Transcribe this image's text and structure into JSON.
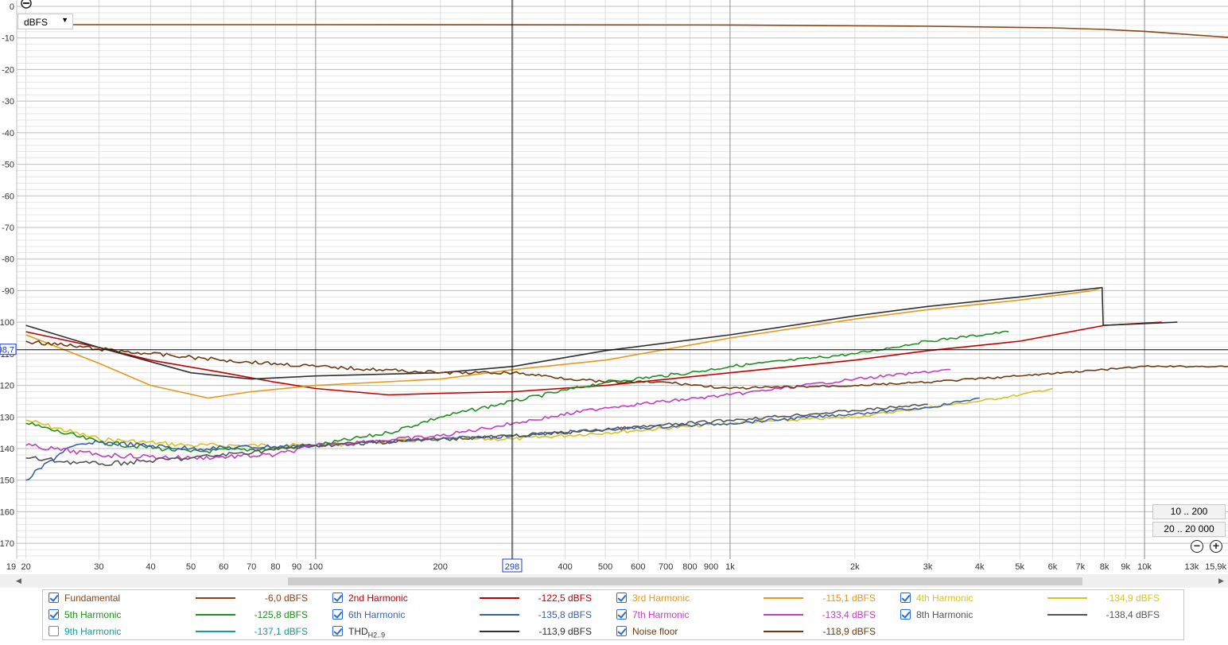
{
  "toolbar": {
    "unit_dropdown": "dBFS",
    "range_button_1": "10 .. 200",
    "range_button_2": "20 .. 20 000"
  },
  "cursor": {
    "x_label": "298",
    "y_label": "98,7"
  },
  "icons": [
    "zoom-out-icon",
    "zoom-in-icon",
    "chevron-down-icon",
    "arrow-left-icon",
    "arrow-right-icon",
    "checkbox-icon"
  ],
  "legend": [
    {
      "name": "Fundamental",
      "value": "-6,0 dBFS",
      "checked": true,
      "color": "#8b4513"
    },
    {
      "name": "2nd Harmonic",
      "value": "-122,5 dBFS",
      "checked": true,
      "color": "#c00000"
    },
    {
      "name": "3rd Harmonic",
      "value": "-115,1 dBFS",
      "checked": true,
      "color": "#e39a1a"
    },
    {
      "name": "4th Harmonic",
      "value": "-134,9 dBFS",
      "checked": true,
      "color": "#d9c41a"
    },
    {
      "name": "5th Harmonic",
      "value": "-125,8 dBFS",
      "checked": true,
      "color": "#1f8f1f"
    },
    {
      "name": "6th Harmonic",
      "value": "-135,8 dBFS",
      "checked": true,
      "color": "#3c60a8"
    },
    {
      "name": "7th Harmonic",
      "value": "-133,4 dBFS",
      "checked": true,
      "color": "#c040c0"
    },
    {
      "name": "8th Harmonic",
      "value": "-138,4 dBFS",
      "checked": true,
      "color": "#555555"
    },
    {
      "name": "9th Harmonic",
      "value": "-137,1 dBFS",
      "checked": false,
      "color": "#1a9a9a"
    },
    {
      "name": "THD",
      "name_sub": "H2..9",
      "value": "-113,9 dBFS",
      "checked": true,
      "color": "#303030"
    },
    {
      "name": "Noise floor",
      "value": "-118,9 dBFS",
      "checked": true,
      "color": "#6b3a10"
    }
  ],
  "chart_data": {
    "type": "line",
    "x_scale": "log",
    "x_unit": "Hz",
    "xlim": [
      19,
      15900
    ],
    "ylim": [
      0,
      -175
    ],
    "grid": true,
    "y_ticks": [
      0,
      -10,
      -20,
      -30,
      -40,
      -50,
      -60,
      -70,
      -80,
      -90,
      -100,
      -110,
      -120,
      -130,
      -140,
      -150,
      -160,
      -170
    ],
    "y_tick_labels": [
      "0",
      "-10",
      "-20",
      "-30",
      "-40",
      "-50",
      "-60",
      "-70",
      "-80",
      "-90",
      "100",
      "110",
      "120",
      "130",
      "140",
      "150",
      "160",
      "170"
    ],
    "x_ticks": [
      19,
      20,
      30,
      40,
      50,
      60,
      70,
      80,
      90,
      100,
      200,
      400,
      500,
      600,
      700,
      800,
      900,
      1000,
      2000,
      3000,
      4000,
      5000,
      6000,
      7000,
      8000,
      9000,
      10000,
      13000,
      15900
    ],
    "x_tick_labels": [
      "19",
      "20",
      "30",
      "40",
      "50",
      "60",
      "70",
      "80",
      "90",
      "100",
      "200",
      "400",
      "500",
      "600",
      "700",
      "800",
      "900",
      "1k",
      "2k",
      "3k",
      "4k",
      "5k",
      "6k",
      "7k",
      "8k",
      "9k",
      "10k",
      "13k",
      "15,9k"
    ],
    "cursor": {
      "x": 298,
      "y": -108.7
    },
    "series": [
      {
        "name": "Fundamental",
        "color": "#8b4513",
        "x": [
          20,
          100,
          1000,
          3000,
          6000,
          8000,
          10000,
          13000,
          15900
        ],
        "y": [
          -5.8,
          -5.8,
          -5.9,
          -6.3,
          -6.8,
          -7.3,
          -7.9,
          -9.0,
          -9.8
        ]
      },
      {
        "name": "2nd Harmonic",
        "color": "#c00000",
        "x": [
          20,
          30,
          40,
          60,
          80,
          100,
          150,
          200,
          300,
          500,
          1000,
          2000,
          3000,
          5000,
          8000,
          11000
        ],
        "y": [
          -103,
          -108,
          -112,
          -116,
          -119,
          -121,
          -123,
          -122.5,
          -122,
          -120,
          -116,
          -112,
          -109,
          -106,
          -101,
          -100
        ]
      },
      {
        "name": "3rd Harmonic",
        "color": "#e39a1a",
        "x": [
          20,
          30,
          40,
          55,
          70,
          100,
          200,
          300,
          500,
          1000,
          2000,
          3000,
          5000,
          7500,
          7900
        ],
        "y": [
          -104,
          -113,
          -120,
          -124,
          -122,
          -120,
          -118,
          -115,
          -112,
          -105,
          -99,
          -96,
          -93,
          -90,
          -89
        ]
      },
      {
        "name": "4th Harmonic",
        "color": "#d9c41a",
        "x": [
          20,
          30,
          50,
          100,
          200,
          300,
          500,
          800,
          1000,
          2000,
          3000,
          4000,
          5000,
          6000
        ],
        "y": [
          -131,
          -137,
          -139,
          -139,
          -137,
          -137,
          -135,
          -133,
          -132,
          -130,
          -127,
          -125,
          -123,
          -121
        ]
      },
      {
        "name": "5th Harmonic",
        "color": "#1f8f1f",
        "x": [
          20,
          30,
          50,
          80,
          100,
          150,
          200,
          300,
          500,
          800,
          1000,
          2000,
          3000,
          4700
        ],
        "y": [
          -132,
          -138,
          -141,
          -140,
          -139,
          -135,
          -130,
          -125,
          -119,
          -116,
          -114,
          -110,
          -106,
          -103
        ]
      },
      {
        "name": "6th Harmonic",
        "color": "#3c60a8",
        "x": [
          20,
          25,
          30,
          50,
          100,
          200,
          300,
          500,
          1000,
          2000,
          3000,
          4000
        ],
        "y": [
          -150,
          -140,
          -138,
          -140,
          -139,
          -137,
          -136,
          -134,
          -132,
          -129,
          -127,
          -124
        ]
      },
      {
        "name": "7th Harmonic",
        "color": "#c040c0",
        "x": [
          20,
          30,
          50,
          80,
          100,
          200,
          300,
          500,
          1000,
          2000,
          3400
        ],
        "y": [
          -139,
          -142,
          -143,
          -142,
          -139,
          -136,
          -132,
          -127,
          -123,
          -118,
          -115
        ]
      },
      {
        "name": "8th Harmonic",
        "color": "#555555",
        "x": [
          20,
          30,
          50,
          100,
          200,
          300,
          500,
          1000,
          2000,
          3000
        ],
        "y": [
          -143,
          -145,
          -143,
          -139,
          -137,
          -136,
          -134,
          -131,
          -128,
          -126
        ]
      },
      {
        "name": "THD H2..9",
        "color": "#303030",
        "x": [
          20,
          30,
          50,
          70,
          100,
          200,
          300,
          500,
          1000,
          2000,
          3000,
          5000,
          7900,
          7950,
          12000
        ],
        "y": [
          -101,
          -108,
          -116,
          -118,
          -117,
          -116,
          -114,
          -109,
          -104,
          -98,
          -95,
          -92,
          -89,
          -101,
          -100
        ]
      },
      {
        "name": "Noise floor",
        "color": "#6b3a10",
        "x": [
          20,
          30,
          40,
          60,
          100,
          200,
          300,
          500,
          700,
          1000,
          2000,
          3000,
          5000,
          8000,
          10000,
          15900
        ],
        "y": [
          -106,
          -108.5,
          -110,
          -112,
          -114,
          -116,
          -116,
          -119,
          -119,
          -121,
          -120,
          -119,
          -117,
          -115,
          -114,
          -114
        ]
      }
    ]
  }
}
